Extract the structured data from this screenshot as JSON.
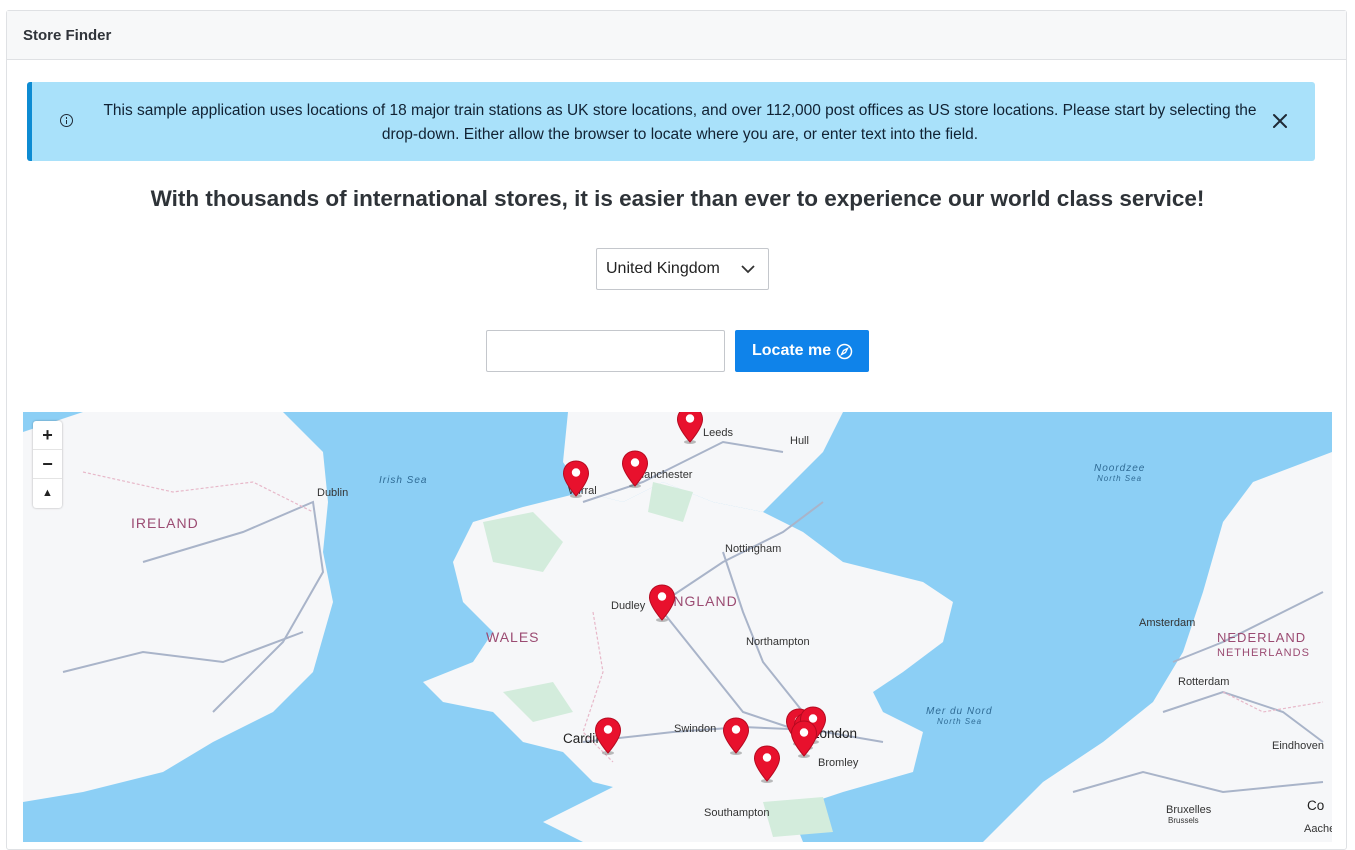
{
  "header": {
    "title": "Store Finder"
  },
  "alert": {
    "text": "This sample application uses locations of 18 major train stations as UK store locations, and over 112,000 post offices as US store locations. Please start by selecting the drop-down. Either allow the browser to locate where you are, or enter text into the field.",
    "icon": "info-icon",
    "close_icon": "close-icon"
  },
  "headline": "With thousands of international stores, it is easier than ever to experience our world class service!",
  "country_select": {
    "value": "United Kingdom"
  },
  "search": {
    "value": "",
    "button_label": "Locate me"
  },
  "map": {
    "zoom_in": "+",
    "zoom_out": "−",
    "reset": "▲",
    "labels": {
      "dublin": "Dublin",
      "ireland": "IRELAND",
      "irish_sea": "Irish Sea",
      "leeds": "Leeds",
      "hull": "Hull",
      "wirral": "Wirral",
      "manchester": "Manchester",
      "nottingham": "Nottingham",
      "noordzee": "Noordzee",
      "north_sea": "North Sea",
      "dudley": "Dudley",
      "england": "ENGLAND",
      "wales": "WALES",
      "northampton": "Northampton",
      "amsterdam": "Amsterdam",
      "nederland": "NEDERLAND",
      "netherlands": "NETHERLANDS",
      "rotterdam": "Rotterdam",
      "mer_du_nord": "Mer du Nord",
      "north_sea_2": "North Sea",
      "cardiff": "Cardiff",
      "swindon": "Swindon",
      "london": "London",
      "bromley": "Bromley",
      "eindhoven": "Eindhoven",
      "southampton": "Southampton",
      "bruxelles": "Bruxelles",
      "brussels": "Brussels",
      "aachen": "Aachen",
      "co": "Co"
    },
    "store_pin_count": 11
  },
  "colors": {
    "primary": "#0f83ea",
    "alert_bg": "#a9e1fa",
    "alert_border": "#0d8bd2",
    "sea": "#8ccff5",
    "land": "#f6f7f9",
    "pin": "#e8112d"
  }
}
